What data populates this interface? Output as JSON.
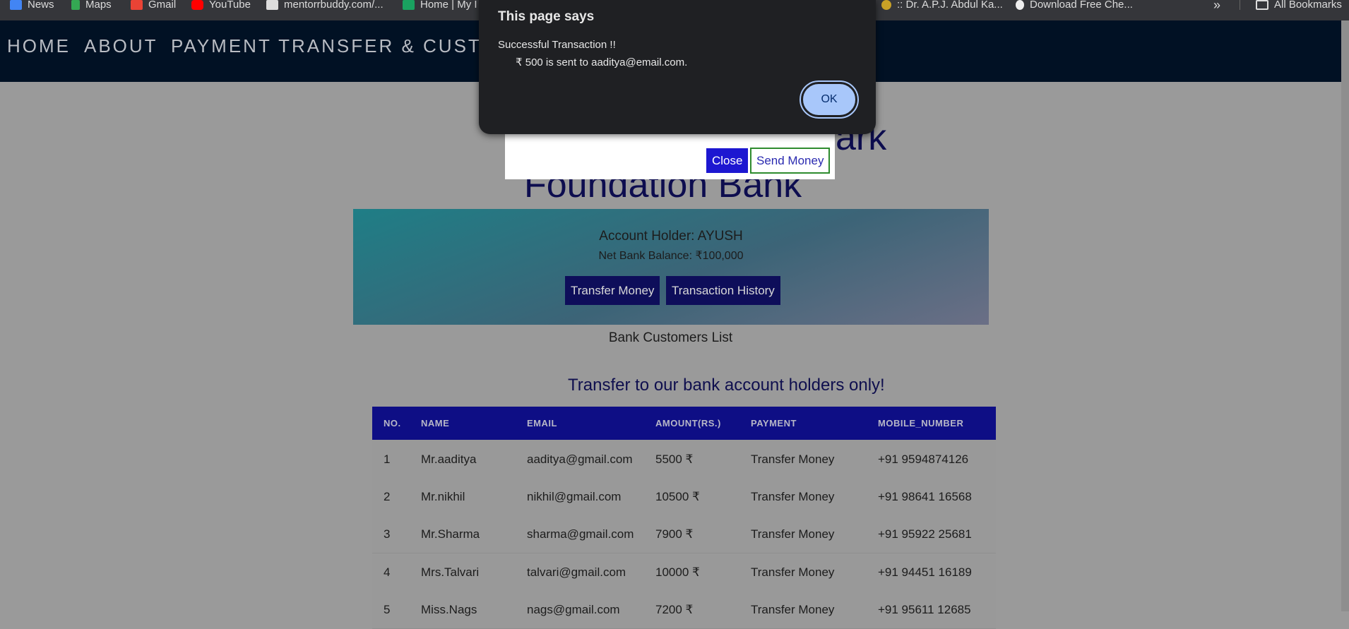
{
  "bookmarks": [
    {
      "label": "News",
      "color": "#4285f4"
    },
    {
      "label": "Maps",
      "color": "#34a853"
    },
    {
      "label": "Gmail",
      "color": "#ea4335"
    },
    {
      "label": "YouTube",
      "color": "#ff0000"
    },
    {
      "label": "mentorrbuddy.com/...",
      "color": "#dddddd"
    },
    {
      "label": "Home | My I",
      "color": "#1aa260"
    },
    {
      "label": ":: Dr. A.P.J. Abdul Ka...",
      "color": "#c9a227"
    },
    {
      "label": "Download Free Che...",
      "color": "#eeeeee"
    }
  ],
  "bookmarks_overflow": "»",
  "all_bookmarks": "All Bookmarks",
  "nav": {
    "home": "HOME",
    "about": "ABOUT",
    "payment": "PAYMENT TRANSFER & CUSTO"
  },
  "title_part1": "ark",
  "title_part2": "Foundation Bank",
  "account": {
    "holder": "Account Holder: AYUSH",
    "balance": "Net Bank Balance: ₹100,000",
    "transfer_btn": "Transfer Money",
    "history_btn": "Transaction History"
  },
  "customers_title": "Bank Customers List",
  "transfer_note": "Transfer to our bank account holders only!",
  "table": {
    "headers": [
      "NO.",
      "NAME",
      "EMAIL",
      "AMOUNT(RS.)",
      "PAYMENT",
      "MOBILE_NUMBER"
    ],
    "rows": [
      [
        "1",
        "Mr.aaditya",
        "aaditya@gmail.com",
        "5500 ₹",
        "Transfer Money",
        "+91 9594874126"
      ],
      [
        "2",
        "Mr.nikhil",
        "nikhil@gmail.com",
        "10500 ₹",
        "Transfer Money",
        "+91 98641 16568"
      ],
      [
        "3",
        "Mr.Sharma",
        "sharma@gmail.com",
        "7900 ₹",
        "Transfer Money",
        "+91 95922 25681"
      ],
      [
        "4",
        "Mrs.Talvari",
        "talvari@gmail.com",
        "10000 ₹",
        "Transfer Money",
        "+91 94451 16189"
      ],
      [
        "5",
        "Miss.Nags",
        "nags@gmail.com",
        "7200 ₹",
        "Transfer Money",
        "+91 95611 12685"
      ]
    ]
  },
  "modal": {
    "close": "Close",
    "send": "Send Money"
  },
  "alert": {
    "title": "This page says",
    "line1": "Successful Transaction !!",
    "line2": "₹ 500 is sent to aaditya@email.com.",
    "ok": "OK"
  }
}
